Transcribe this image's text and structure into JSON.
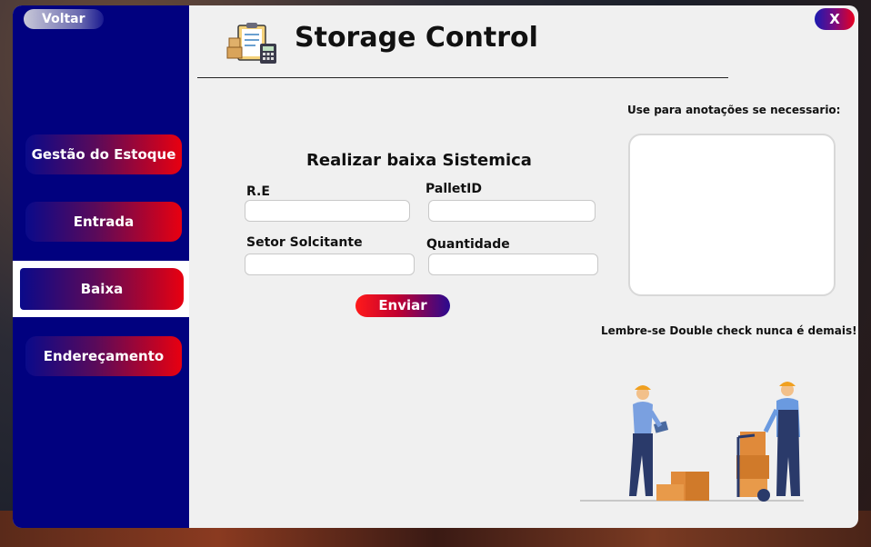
{
  "app": {
    "title": "Storage Control",
    "close_label": "X"
  },
  "sidebar": {
    "back_label": "Voltar",
    "items": [
      {
        "label": "Gestão do Estoque",
        "active": false
      },
      {
        "label": "Entrada",
        "active": false
      },
      {
        "label": "Baixa",
        "active": true
      },
      {
        "label": "Endereçamento",
        "active": false
      }
    ]
  },
  "form": {
    "title": "Realizar baixa Sistemica",
    "fields": {
      "re": {
        "label": "R.E",
        "value": ""
      },
      "pallet_id": {
        "label": "PalletID",
        "value": ""
      },
      "setor": {
        "label": "Setor Solcitante",
        "value": ""
      },
      "quantidade": {
        "label": "Quantidade",
        "value": ""
      }
    },
    "submit_label": "Enviar"
  },
  "notes": {
    "label": "Use para anotações se necessario:",
    "value": ""
  },
  "reminder": "Lembre-se Double check nunca é demais!",
  "colors": {
    "sidebar": "#01017f",
    "accent_red": "#e80010",
    "window_bg": "#f0f0f0"
  },
  "icons": {
    "logo": "clipboard-boxes-calculator-icon",
    "illustration": "warehouse-workers-boxes-illustration"
  }
}
